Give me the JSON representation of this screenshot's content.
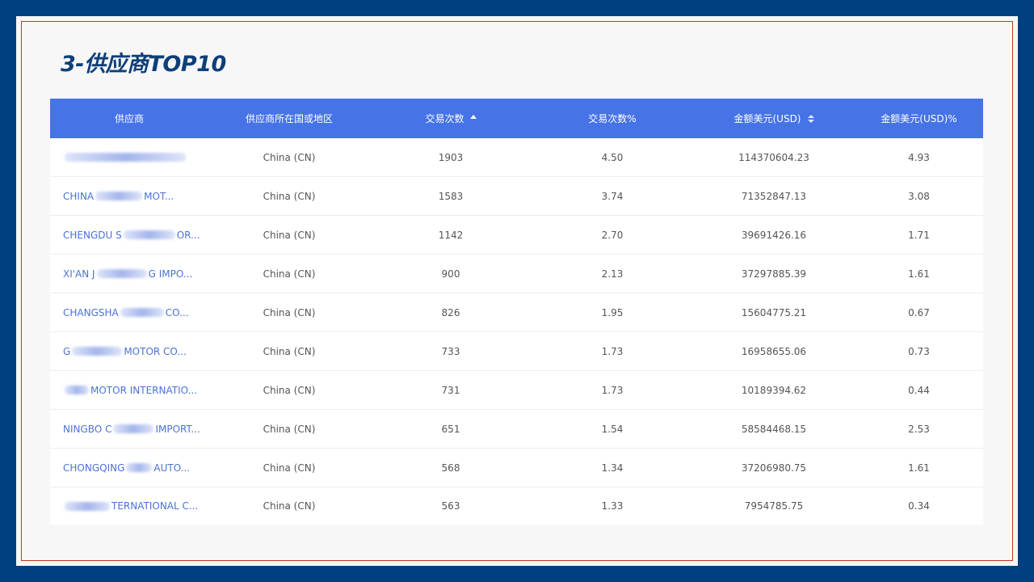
{
  "title": "3-供应商TOP10",
  "table": {
    "headers": {
      "supplier": "供应商",
      "country": "供应商所在国或地区",
      "transactions": "交易次数",
      "transactions_pct": "交易次数%",
      "amount": "金额美元(USD)",
      "amount_pct": "金额美元(USD)%"
    },
    "rows": [
      {
        "supplier_prefix": "",
        "supplier_suffix": "",
        "country": "China (CN)",
        "transactions": "1903",
        "transactions_pct": "4.50",
        "amount": "114370604.23",
        "amount_pct": "4.93"
      },
      {
        "supplier_prefix": "CHINA",
        "supplier_suffix": "MOT...",
        "country": "China (CN)",
        "transactions": "1583",
        "transactions_pct": "3.74",
        "amount": "71352847.13",
        "amount_pct": "3.08"
      },
      {
        "supplier_prefix": "CHENGDU S",
        "supplier_suffix": "OR...",
        "country": "China (CN)",
        "transactions": "1142",
        "transactions_pct": "2.70",
        "amount": "39691426.16",
        "amount_pct": "1.71"
      },
      {
        "supplier_prefix": "XI'AN J",
        "supplier_suffix": "G IMPO...",
        "country": "China (CN)",
        "transactions": "900",
        "transactions_pct": "2.13",
        "amount": "37297885.39",
        "amount_pct": "1.61"
      },
      {
        "supplier_prefix": "CHANGSHA",
        "supplier_suffix": "CO...",
        "country": "China (CN)",
        "transactions": "826",
        "transactions_pct": "1.95",
        "amount": "15604775.21",
        "amount_pct": "0.67"
      },
      {
        "supplier_prefix": "G",
        "supplier_suffix": "MOTOR CO...",
        "country": "China (CN)",
        "transactions": "733",
        "transactions_pct": "1.73",
        "amount": "16958655.06",
        "amount_pct": "0.73"
      },
      {
        "supplier_prefix": "",
        "supplier_suffix": "MOTOR INTERNATIO...",
        "country": "China (CN)",
        "transactions": "731",
        "transactions_pct": "1.73",
        "amount": "10189394.62",
        "amount_pct": "0.44"
      },
      {
        "supplier_prefix": "NINGBO C",
        "supplier_suffix": "IMPORT...",
        "country": "China (CN)",
        "transactions": "651",
        "transactions_pct": "1.54",
        "amount": "58584468.15",
        "amount_pct": "2.53"
      },
      {
        "supplier_prefix": "CHONGQING",
        "supplier_suffix": "AUTO...",
        "country": "China (CN)",
        "transactions": "568",
        "transactions_pct": "1.34",
        "amount": "37206980.75",
        "amount_pct": "1.61"
      },
      {
        "supplier_prefix": "",
        "supplier_suffix": "TERNATIONAL C...",
        "country": "China (CN)",
        "transactions": "563",
        "transactions_pct": "1.33",
        "amount": "7954785.75",
        "amount_pct": "0.34"
      }
    ]
  },
  "colors": {
    "frame": "#003f80",
    "header_bg": "#4673e6",
    "link": "#4a72d6",
    "title": "#0d3f7a",
    "inner_border": "#c0392b"
  }
}
